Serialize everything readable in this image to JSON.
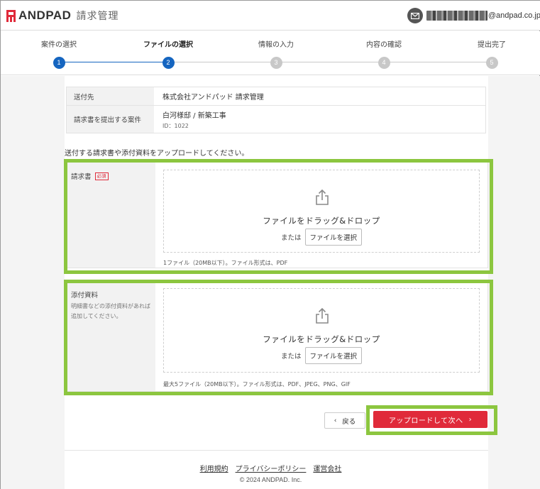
{
  "header": {
    "brand": "ANDPAD",
    "product": "請求管理",
    "email_domain": "@andpad.co.jp",
    "icons": {
      "logo": "andpad-logo-icon",
      "mail": "mail-icon"
    }
  },
  "stepper": {
    "steps": [
      {
        "label": "案件の選択",
        "number": "1",
        "state": "done"
      },
      {
        "label": "ファイルの選択",
        "number": "2",
        "state": "current"
      },
      {
        "label": "情報の入力",
        "number": "3",
        "state": "todo"
      },
      {
        "label": "内容の確認",
        "number": "4",
        "state": "todo"
      },
      {
        "label": "提出完了",
        "number": "5",
        "state": "todo"
      }
    ],
    "colors": {
      "active": "#1565c0",
      "todo": "#c8c8c8"
    }
  },
  "info": {
    "rows": [
      {
        "label": "送付先",
        "value": "株式会社アンドパッド 請求管理",
        "sub": ""
      },
      {
        "label": "請求書を提出する案件",
        "value": "白河様邸 / 新築工事",
        "sub": "ID：1022"
      }
    ]
  },
  "instruction": "送付する請求書や添付資料をアップロードしてください。",
  "invoice_section": {
    "title": "請求書",
    "required_badge": "必須",
    "drop_text": "ファイルをドラッグ&ドロップ",
    "or_text": "または",
    "select_label": "ファイルを選択",
    "hint": "1ファイル（20MB以下）。ファイル形式は、PDF"
  },
  "attachment_section": {
    "title": "添付資料",
    "note_line1": "明細書などの添付資料があれば",
    "note_line2": "追加してください。",
    "drop_text": "ファイルをドラッグ&ドロップ",
    "or_text": "または",
    "select_label": "ファイルを選択",
    "hint": "最大5ファイル（20MB以下）。ファイル形式は、PDF、JPEG、PNG、GIF"
  },
  "actions": {
    "back_label": "戻る",
    "next_label": "アップロードして次へ",
    "next_color": "#e02a3a",
    "highlight_color": "#8cc63f"
  },
  "footer": {
    "links": [
      "利用規約",
      "プライバシーポリシー",
      "運営会社"
    ],
    "copyright": "© 2024 ANDPAD. Inc."
  }
}
